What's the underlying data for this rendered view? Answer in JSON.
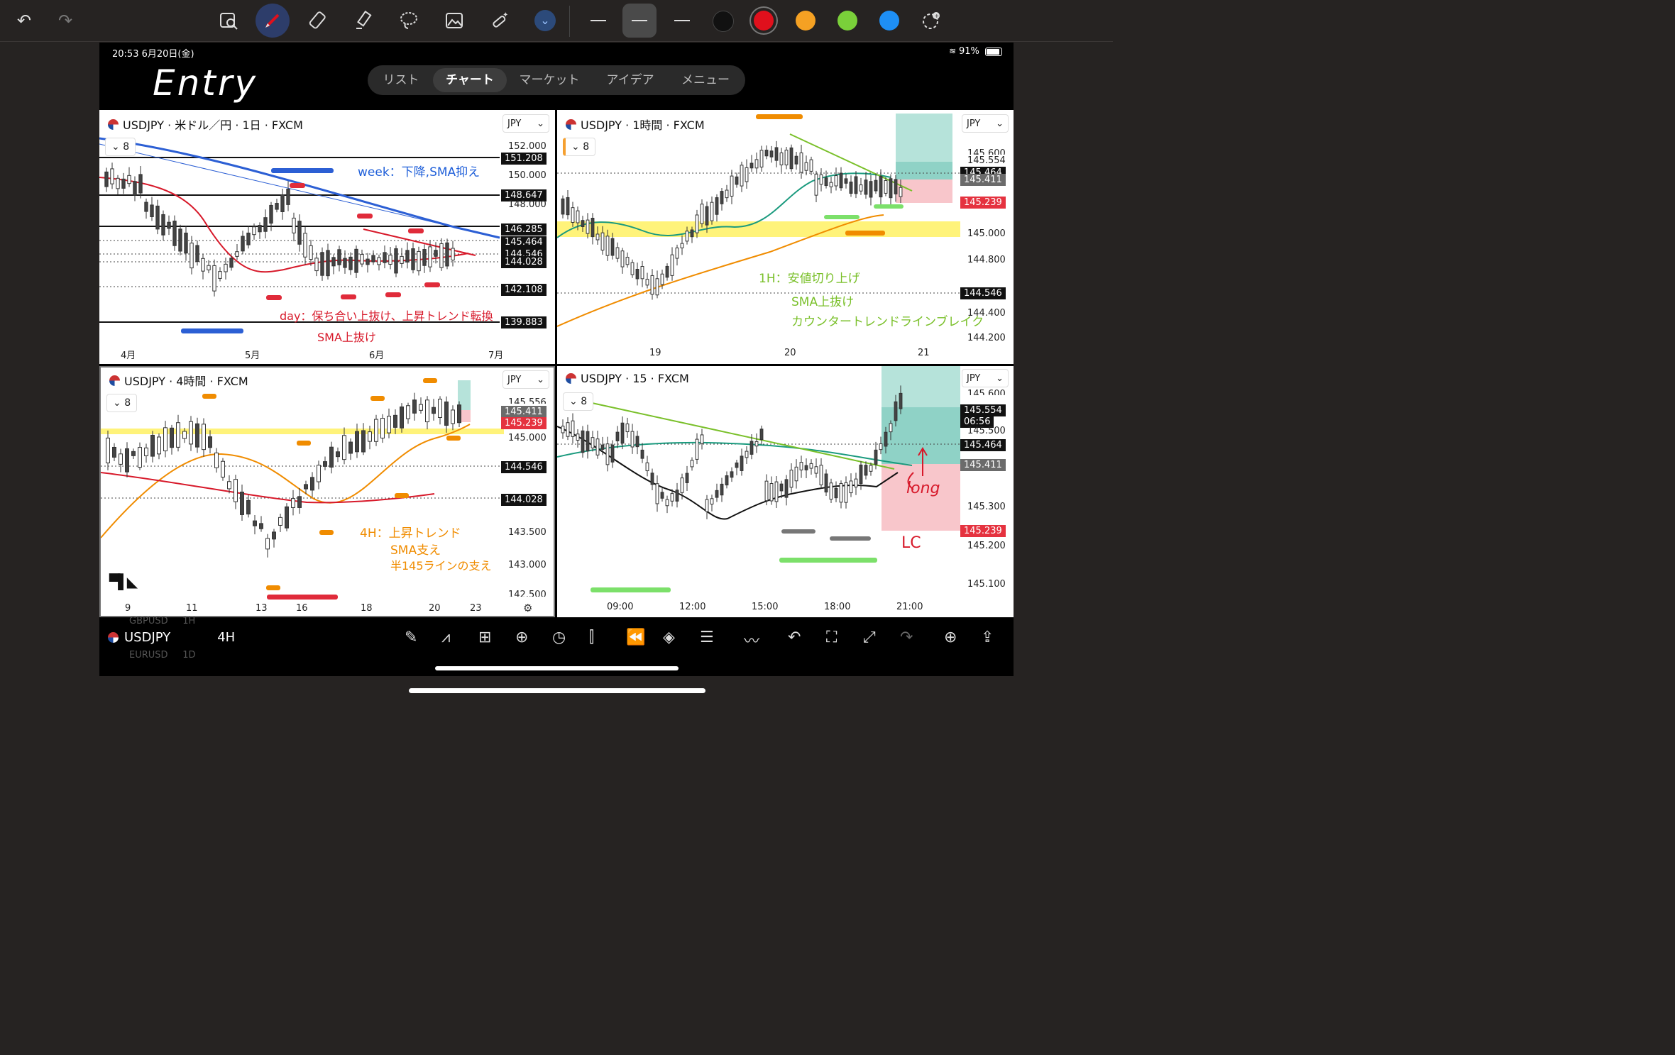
{
  "colors": {
    "accent_red": "#d7192a",
    "accent_blue": "#1f5fd9",
    "accent_orange": "#f08c00",
    "accent_green": "#7ac02a",
    "highlight": "#fff37a"
  },
  "toolbar": {
    "tools": [
      {
        "icon": "undo-icon",
        "glyph": "↶"
      },
      {
        "icon": "redo-icon",
        "glyph": "↷"
      },
      {
        "icon": "image-search-icon",
        "glyph": "⌕"
      },
      {
        "icon": "pen-icon",
        "glyph": "✎"
      },
      {
        "icon": "eraser-icon",
        "glyph": "⌫"
      },
      {
        "icon": "highlighter-icon",
        "glyph": "✐"
      },
      {
        "icon": "lasso-icon",
        "glyph": "◌"
      },
      {
        "icon": "image-icon",
        "glyph": "▣"
      },
      {
        "icon": "magic-wand-icon",
        "glyph": "✦"
      },
      {
        "icon": "chevron-down-icon",
        "glyph": "⌄"
      }
    ],
    "swatches": [
      "#111111",
      "#e0101c",
      "#f5a123",
      "#7ad03a",
      "#1e8ff5"
    ],
    "add_color_icon": "add-color-icon"
  },
  "status": {
    "time": "20:53  6月20日(金)",
    "battery": "91%"
  },
  "handwriting": {
    "entry": "Entry"
  },
  "nav": {
    "tabs": [
      "リスト",
      "チャート",
      "マーケット",
      "アイデア",
      "メニュー"
    ],
    "active": 1
  },
  "panels": {
    "daily": {
      "title": "USDJPY · 米ドル／円 · 1日 · FXCM",
      "currency": "JPY",
      "badge": "8",
      "prices": [
        "152.000",
        "151.208",
        "150.000",
        "148.647",
        "148.000",
        "146.285",
        "145.464",
        "144.546",
        "144.028",
        "142.108",
        "139.883"
      ],
      "xlabels": [
        "4月",
        "5月",
        "6月",
        "7月"
      ],
      "ann_week": "week：下降,SMA抑え",
      "ann_day": "day：保ち合い上抜け、上昇トレンド転換",
      "ann_sma": "SMA上抜け"
    },
    "h1": {
      "title": "USDJPY · 1時間 · FXCM",
      "currency": "JPY",
      "badge": "8",
      "prices": [
        "145.600",
        "145.554",
        "145.464",
        "145.411",
        "145.239",
        "145.000",
        "144.800",
        "144.546",
        "144.400",
        "144.200"
      ],
      "xlabels": [
        "19",
        "20",
        "21"
      ],
      "ann1": "1H：安値切り上げ",
      "ann2": "SMA上抜け",
      "ann3": "カウンタートレンドラインブレイク"
    },
    "h4": {
      "title": "USDJPY · 4時間 · FXCM",
      "currency": "JPY",
      "badge": "8",
      "prices": [
        "145.556",
        "145.411",
        "145.239",
        "145.000",
        "144.546",
        "144.028",
        "143.500",
        "143.000",
        "142.500"
      ],
      "xlabels": [
        "9",
        "11",
        "13",
        "16",
        "18",
        "20",
        "23"
      ],
      "ann1": "4H：上昇トレンド",
      "ann2": "SMA支え",
      "ann3": "半145ラインの支え"
    },
    "m15": {
      "title": "USDJPY · 15 · FXCM",
      "currency": "JPY",
      "badge": "8",
      "prices": [
        "145.600",
        "145.554",
        "06:56",
        "145.500",
        "145.464",
        "145.411",
        "145.300",
        "145.239",
        "145.200",
        "145.100"
      ],
      "xlabels": [
        "09:00",
        "12:00",
        "15:00",
        "18:00",
        "21:00"
      ],
      "ann_long": "long",
      "ann_lc": "LC"
    }
  },
  "bottom": {
    "symbol": "USDJPY",
    "interval": "4H",
    "ghost_prev": "GBPUSD",
    "ghost_prev_iv": "1H",
    "ghost_next": "EURUSD",
    "ghost_next_iv": "1D",
    "icons": [
      "pencil-icon",
      "indicators-icon",
      "layout-icon",
      "add-icon",
      "alert-icon",
      "candles-icon",
      "replay-icon",
      "layers-icon",
      "settings-icon",
      "compare-icon",
      "undo-icon",
      "fullscreen-icon",
      "expand-icon",
      "redo-icon",
      "add-alert-icon",
      "share-icon"
    ],
    "glyphs": [
      "✎",
      "⩘",
      "⊞",
      "⊕",
      "◷",
      "⫿",
      "⏪",
      "◈",
      "☰",
      "〰",
      "↶",
      "⛶",
      "⤢",
      "↷",
      "⊕",
      "⇪"
    ]
  }
}
